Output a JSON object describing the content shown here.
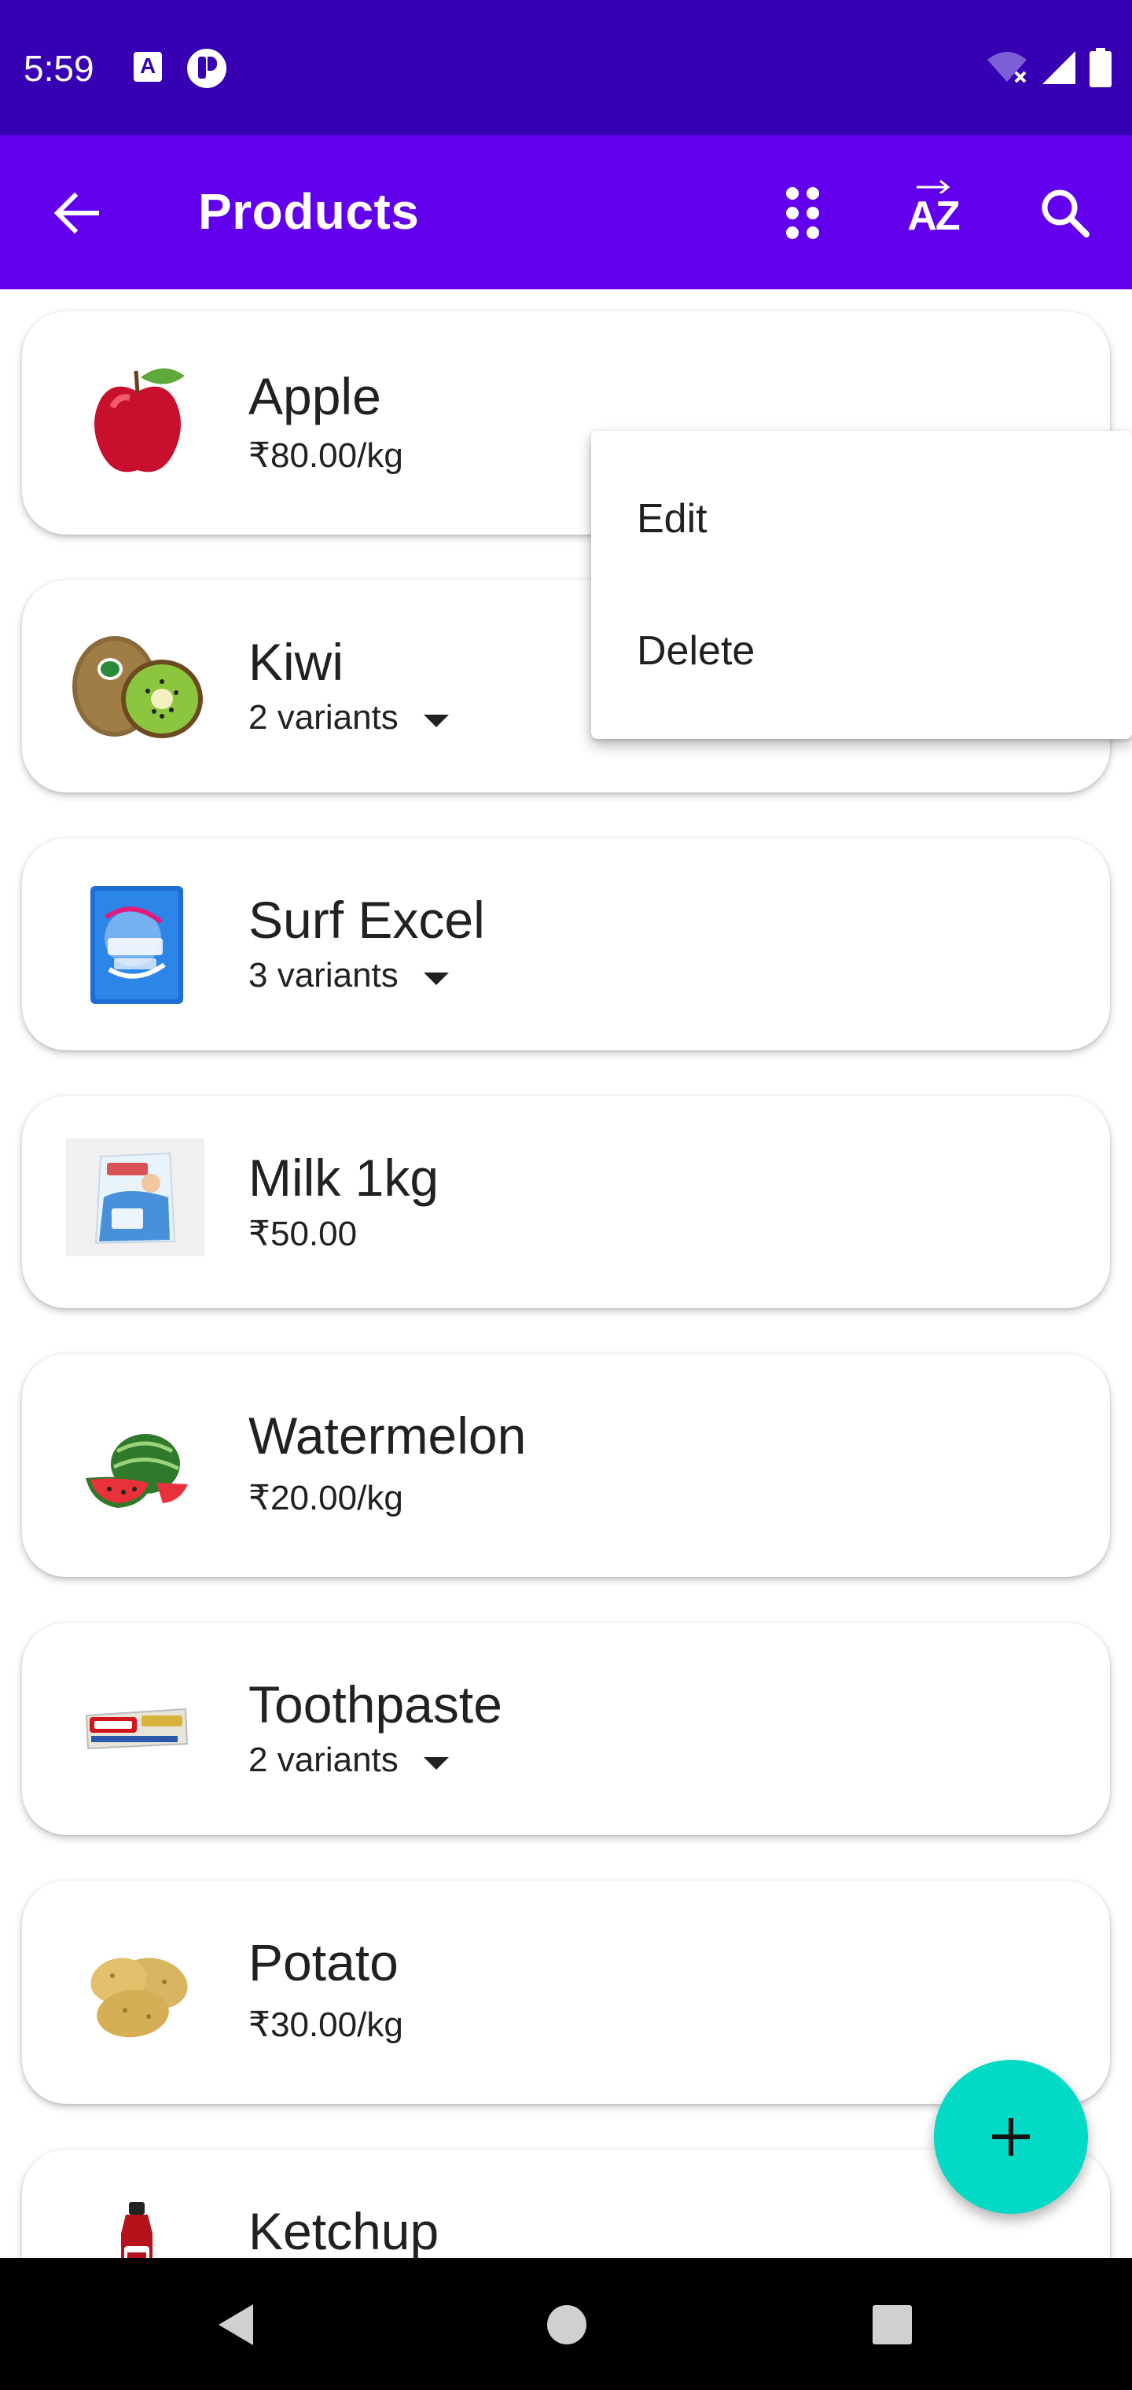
{
  "status_bar": {
    "time": "5:59",
    "icons": [
      "a-notification-icon",
      "p-app-icon",
      "wifi-off-icon",
      "signal-icon",
      "battery-icon"
    ],
    "a_glyph": "A"
  },
  "app_bar": {
    "title": "Products",
    "icons": [
      "back-arrow-icon",
      "grid-dots-icon",
      "sort-az-icon",
      "search-icon"
    ],
    "sort_glyph": "AZ"
  },
  "products": [
    {
      "name": "Apple",
      "subtitle": "₹80.00/kg",
      "has_variants": false,
      "icon": "apple-image"
    },
    {
      "name": "Kiwi",
      "subtitle": "2 variants",
      "has_variants": true,
      "icon": "kiwi-image"
    },
    {
      "name": "Surf Excel",
      "subtitle": "3 variants",
      "has_variants": true,
      "icon": "surf-excel-image"
    },
    {
      "name": "Milk 1kg",
      "subtitle": "₹50.00",
      "has_variants": false,
      "icon": "milk-packet-image"
    },
    {
      "name": "Watermelon",
      "subtitle": "₹20.00/kg",
      "has_variants": false,
      "icon": "watermelon-image"
    },
    {
      "name": "Toothpaste",
      "subtitle": "2 variants",
      "has_variants": true,
      "icon": "toothpaste-image"
    },
    {
      "name": "Potato",
      "subtitle": "₹30.00/kg",
      "has_variants": false,
      "icon": "potato-image"
    },
    {
      "name": "Ketchup",
      "subtitle": "",
      "has_variants": false,
      "icon": "ketchup-image"
    }
  ],
  "popup_menu": {
    "items": [
      "Edit",
      "Delete"
    ]
  },
  "fab": {
    "icon": "plus-icon"
  },
  "nav_bar": {
    "icons": [
      "back-triangle-icon",
      "home-circle-icon",
      "recents-square-icon"
    ]
  },
  "colors": {
    "status_bar": "#3700b3",
    "app_bar": "#6200ee",
    "fab": "#03dac5"
  }
}
